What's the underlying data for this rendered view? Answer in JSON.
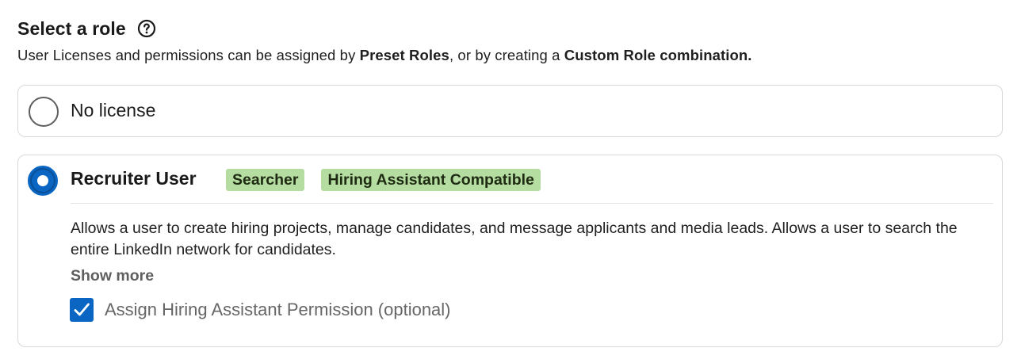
{
  "header": {
    "title": "Select a role",
    "help_icon": "question-circle-icon"
  },
  "subtitle": {
    "part1": "User Licenses and permissions can be assigned by ",
    "bold1": "Preset Roles",
    "part2": ", or by creating a ",
    "bold2": "Custom Role combination."
  },
  "options": [
    {
      "label": "No license",
      "selected": false
    },
    {
      "label": "Recruiter User",
      "selected": true,
      "badges": [
        "Searcher",
        "Hiring Assistant Compatible"
      ],
      "description": "Allows a user to create hiring projects, manage candidates, and message applicants and media leads. Allows a user to search the entire LinkedIn network for candidates.",
      "show_more": "Show more",
      "checkbox": {
        "label": "Assign Hiring Assistant Permission (optional)",
        "checked": true
      }
    }
  ],
  "colors": {
    "accent": "#0a66c2",
    "badge_bg": "#b5dca1",
    "border": "#d9d9d9"
  }
}
